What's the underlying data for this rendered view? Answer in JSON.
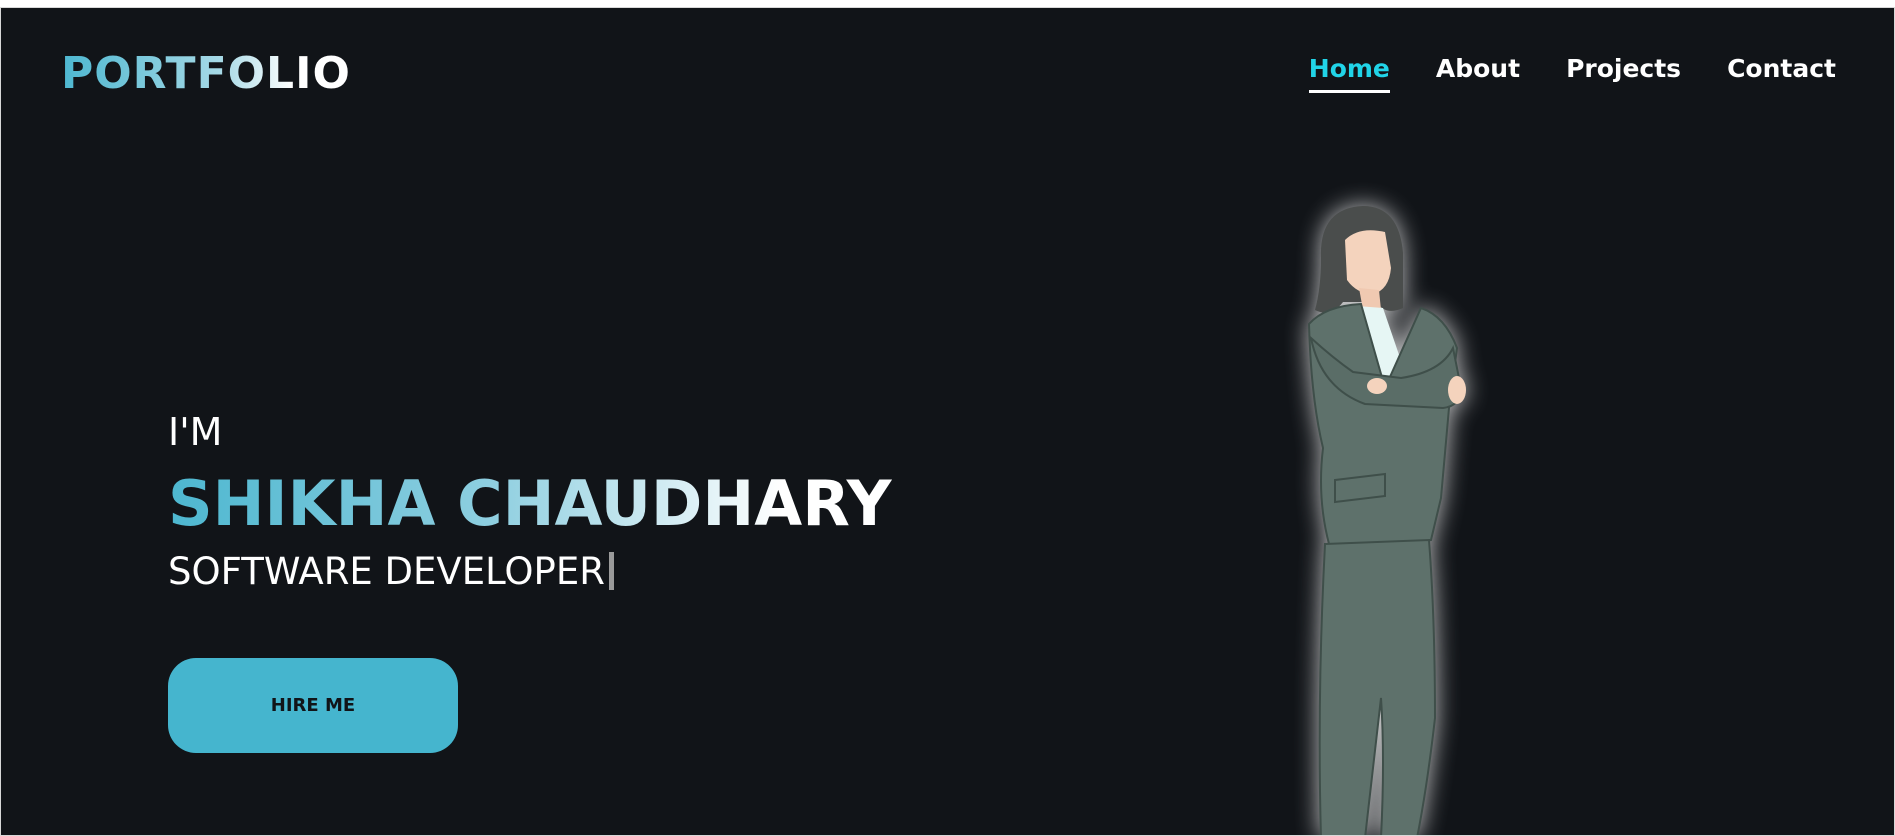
{
  "header": {
    "logo": "PORTFOLIO",
    "nav": [
      {
        "label": "Home",
        "active": true
      },
      {
        "label": "About",
        "active": false
      },
      {
        "label": "Projects",
        "active": false
      },
      {
        "label": "Contact",
        "active": false
      }
    ]
  },
  "hero": {
    "intro": "I'M",
    "name": "SHIKHA CHAUDHARY",
    "role": "SOFTWARE DEVELOPER",
    "button": "HIRE ME"
  },
  "colors": {
    "background": "#111418",
    "accent": "#45b5ce",
    "active_nav": "#21d4e8"
  },
  "icons": {
    "illustration": "woman-in-suit-illustration"
  }
}
